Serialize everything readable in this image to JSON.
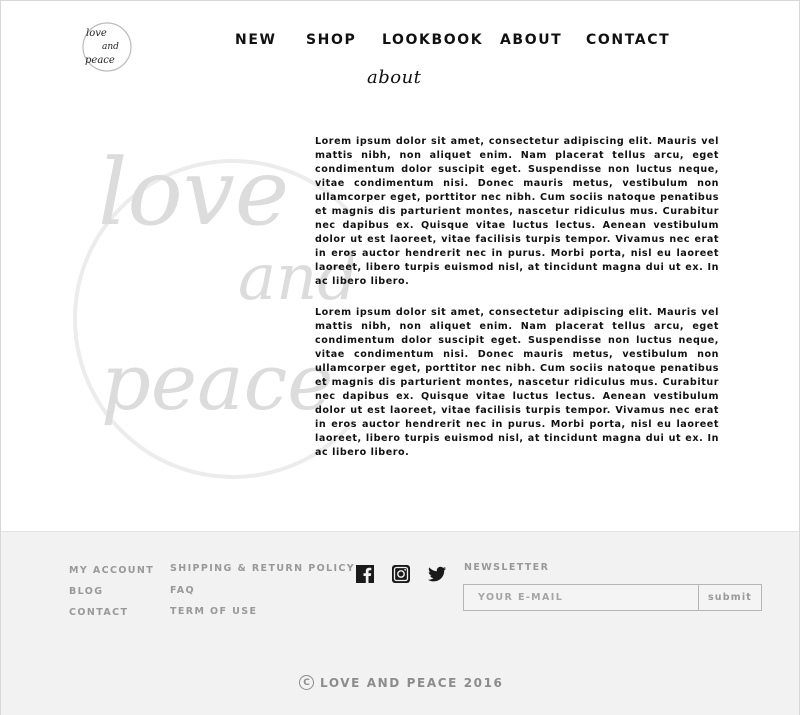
{
  "brand": {
    "logo_text": [
      "love",
      "and",
      "peace"
    ]
  },
  "nav": {
    "items": [
      {
        "label": "NEW"
      },
      {
        "label": "SHOP"
      },
      {
        "label": "LOOKBOOK"
      },
      {
        "label": "ABOUT"
      },
      {
        "label": "CONTACT"
      }
    ]
  },
  "page": {
    "heading": "about",
    "watermark_text": [
      "love",
      "and",
      "peace"
    ],
    "paragraphs": [
      "Lorem ipsum dolor sit amet, consectetur adipiscing elit. Mauris vel mattis nibh, non aliquet enim. Nam placerat tellus arcu, eget condimentum dolor suscipit eget. Suspendisse non luctus neque, vitae condimentum nisi. Donec mauris metus, vestibulum non ullamcorper eget, porttitor nec nibh. Cum sociis natoque penatibus et magnis dis parturient montes, nascetur ridiculus mus. Curabitur nec dapibus ex. Quisque vitae luctus lectus. Aenean vestibulum dolor ut est laoreet, vitae facilisis turpis tempor. Vivamus nec erat in eros auctor hendrerit nec in purus. Morbi porta, nisl eu laoreet laoreet, libero turpis euismod nisl, at tincidunt magna dui ut ex. In ac libero libero.",
      "Lorem ipsum dolor sit amet, consectetur adipiscing elit. Mauris vel mattis nibh, non aliquet enim. Nam placerat tellus arcu, eget condimentum dolor suscipit eget. Suspendisse non luctus neque, vitae condimentum nisi. Donec mauris metus, vestibulum non ullamcorper eget, porttitor nec nibh. Cum sociis natoque penatibus et magnis dis parturient montes, nascetur ridiculus mus. Curabitur nec dapibus ex. Quisque vitae luctus lectus. Aenean vestibulum dolor ut est laoreet, vitae facilisis turpis tempor. Vivamus nec erat in eros auctor hendrerit nec in purus. Morbi porta, nisl eu laoreet laoreet, libero turpis euismod nisl, at tincidunt magna dui ut ex. In ac libero libero."
    ]
  },
  "footer": {
    "col1": [
      "MY ACCOUNT",
      "BLOG",
      "CONTACT"
    ],
    "col2": [
      "SHIPPING & RETURN POLICY",
      "FAQ",
      "TERM OF USE"
    ],
    "social": [
      {
        "icon": "facebook-icon"
      },
      {
        "icon": "instagram-icon"
      },
      {
        "icon": "twitter-icon"
      }
    ],
    "newsletter": {
      "label": "NEWSLETTER",
      "placeholder": "YOUR E-MAIL",
      "submit_label": "submit"
    },
    "copyright_symbol": "C",
    "copyright_text": "LOVE AND PEACE 2016"
  },
  "colors": {
    "text": "#111111",
    "footer_bg": "#f2f2f2",
    "footer_text": "#999999",
    "watermark": "#d4d4d4"
  }
}
